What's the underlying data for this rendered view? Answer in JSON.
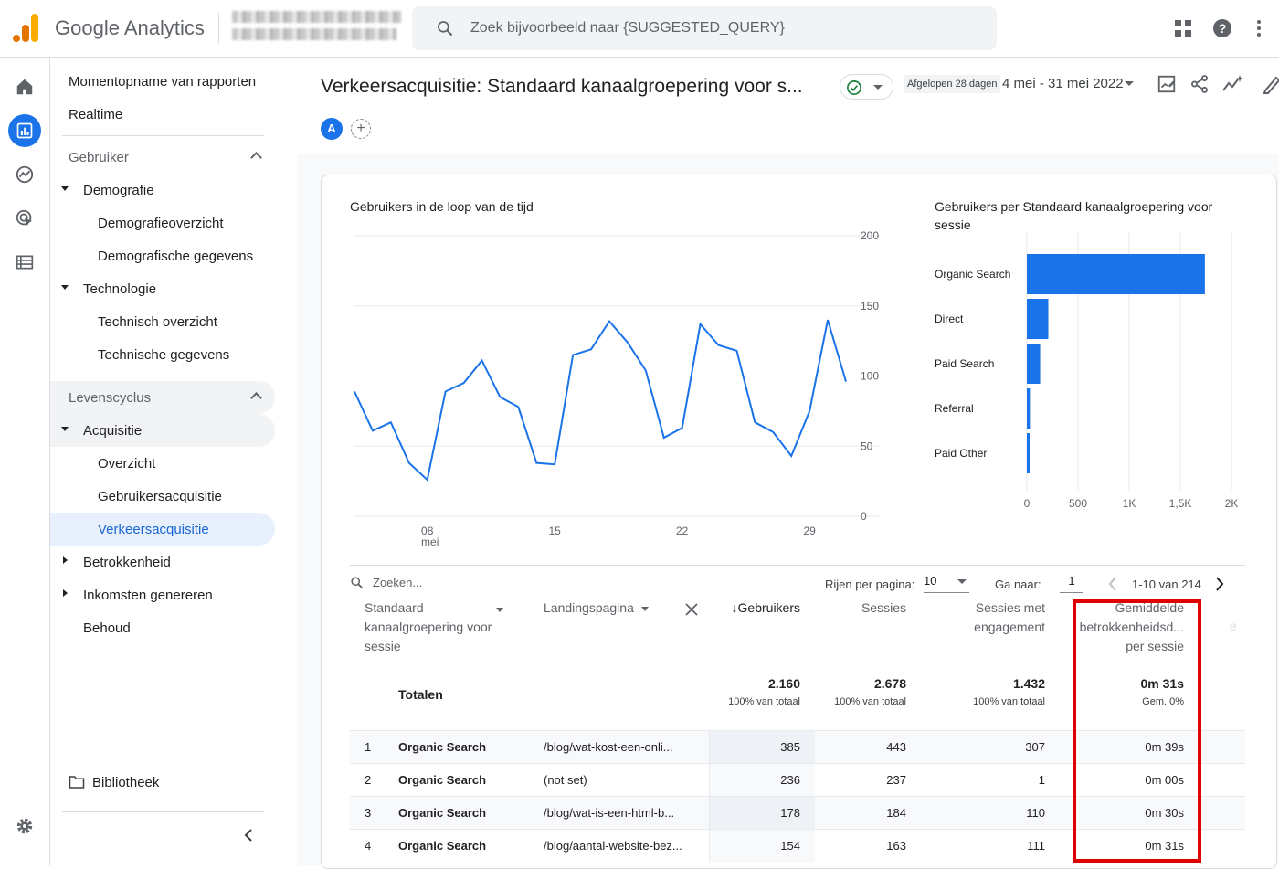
{
  "app": {
    "name": "Google Analytics"
  },
  "search": {
    "placeholder": "Zoek bijvoorbeeld naar {SUGGESTED_QUERY}"
  },
  "nav": {
    "items": [
      {
        "label": "Momentopname van rapporten"
      },
      {
        "label": "Realtime"
      },
      {
        "label": "Gebruiker"
      },
      {
        "label": "Demografie"
      },
      {
        "label": "Demografieoverzicht"
      },
      {
        "label": "Demografische gegevens"
      },
      {
        "label": "Technologie"
      },
      {
        "label": "Technisch overzicht"
      },
      {
        "label": "Technische gegevens"
      },
      {
        "label": "Levenscyclus"
      },
      {
        "label": "Acquisitie"
      },
      {
        "label": "Overzicht"
      },
      {
        "label": "Gebruikersacquisitie"
      },
      {
        "label": "Verkeersacquisitie"
      },
      {
        "label": "Betrokkenheid"
      },
      {
        "label": "Inkomsten genereren"
      },
      {
        "label": "Behoud"
      }
    ],
    "library": "Bibliotheek"
  },
  "header": {
    "title": "Verkeersacquisitie: Standaard kanaalgroepering voor s...",
    "date_chip": "Afgelopen 28 dagen",
    "date_range": "4 mei - 31 mei 2022",
    "avatar": "A"
  },
  "line_chart": {
    "title": "Gebruikers in de loop van de tijd",
    "y_ticks": [
      "200",
      "150",
      "100",
      "50",
      "0"
    ],
    "x_ticks": [
      "08",
      "15",
      "22",
      "29"
    ],
    "x_sub": "mei"
  },
  "bar_chart": {
    "title": "Gebruikers per Standaard kanaalgroepering voor sessie",
    "x_ticks": [
      "0",
      "500",
      "1K",
      "1,5K",
      "2K"
    ]
  },
  "chart_data": [
    {
      "type": "line",
      "title": "Gebruikers in de loop van de tijd",
      "x": [
        "2022-05-04",
        "2022-05-05",
        "2022-05-06",
        "2022-05-07",
        "2022-05-08",
        "2022-05-09",
        "2022-05-10",
        "2022-05-11",
        "2022-05-12",
        "2022-05-13",
        "2022-05-14",
        "2022-05-15",
        "2022-05-16",
        "2022-05-17",
        "2022-05-18",
        "2022-05-19",
        "2022-05-20",
        "2022-05-21",
        "2022-05-22",
        "2022-05-23",
        "2022-05-24",
        "2022-05-25",
        "2022-05-26",
        "2022-05-27",
        "2022-05-28",
        "2022-05-29",
        "2022-05-30",
        "2022-05-31"
      ],
      "series": [
        {
          "values": [
            89,
            61,
            67,
            38,
            26,
            89,
            95,
            111,
            85,
            78,
            38,
            37,
            115,
            119,
            139,
            124,
            104,
            56,
            63,
            137,
            122,
            118,
            67,
            60,
            43,
            75,
            140,
            96
          ]
        }
      ],
      "ylim": [
        0,
        200
      ]
    },
    {
      "type": "bar",
      "title": "Gebruikers per Standaard kanaalgroepering voor sessie",
      "categories": [
        "Organic Search",
        "Direct",
        "Paid Search",
        "Referral",
        "Paid Other"
      ],
      "values": [
        1740,
        210,
        130,
        30,
        25
      ],
      "xlim": [
        0,
        2000
      ]
    }
  ],
  "table": {
    "search_placeholder": "Zoeken...",
    "rows_per_page_label": "Rijen per pagina:",
    "rows_per_page": "10",
    "goto_label": "Ga naar:",
    "goto_value": "1",
    "pager": "1-10 van 214",
    "columns": {
      "dim1": "Standaard kanaalgroepering voor sessie",
      "dim2": "Landingspagina",
      "users": "Gebruikers",
      "sessions": "Sessies",
      "engaged": "Sessies met engagement",
      "avg": "Gemiddelde betrokkenheidsd... per sessie",
      "cut": "e"
    },
    "totals": {
      "label": "Totalen",
      "users": "2.160",
      "users_sub": "100% van totaal",
      "sessions": "2.678",
      "sessions_sub": "100% van totaal",
      "engaged": "1.432",
      "engaged_sub": "100% van totaal",
      "avg": "0m 31s",
      "avg_sub": "Gem. 0%"
    },
    "rows": [
      {
        "n": "1",
        "channel": "Organic Search",
        "page": "/blog/wat-kost-een-onli...",
        "users": "385",
        "sessions": "443",
        "engaged": "307",
        "avg": "0m 39s"
      },
      {
        "n": "2",
        "channel": "Organic Search",
        "page": "(not set)",
        "users": "236",
        "sessions": "237",
        "engaged": "1",
        "avg": "0m 00s"
      },
      {
        "n": "3",
        "channel": "Organic Search",
        "page": "/blog/wat-is-een-html-b...",
        "users": "178",
        "sessions": "184",
        "engaged": "110",
        "avg": "0m 30s"
      },
      {
        "n": "4",
        "channel": "Organic Search",
        "page": "/blog/aantal-website-bez...",
        "users": "154",
        "sessions": "163",
        "engaged": "111",
        "avg": "0m 31s"
      }
    ]
  },
  "colors": {
    "accent": "#1a73e8",
    "highlight": "#e00000"
  }
}
